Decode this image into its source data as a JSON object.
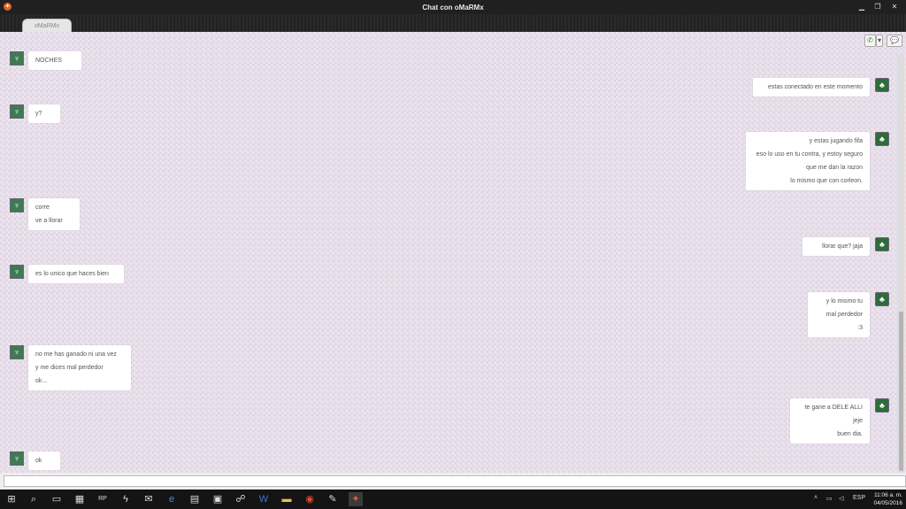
{
  "window": {
    "title": "Chat con oMaRMx"
  },
  "tab": {
    "label": "oMaRMx"
  },
  "toolbar": {
    "call_glyph": "✆",
    "dropdown_glyph": "▾",
    "chat_glyph": "💬"
  },
  "messages": [
    {
      "side": "left",
      "lines": [
        "NOCHES"
      ]
    },
    {
      "side": "right",
      "lines": [
        "estas conectado en este momento"
      ]
    },
    {
      "side": "left",
      "lines": [
        "y?"
      ]
    },
    {
      "side": "right",
      "lines": [
        "y estas jugando fifa",
        "eso lo uso en tu contra, y estoy seguro",
        "que me dan la razon",
        "lo mismo que con corleon."
      ]
    },
    {
      "side": "left",
      "lines": [
        "corre",
        "ve a llorar"
      ]
    },
    {
      "side": "right",
      "lines": [
        "llorar que? jaja"
      ]
    },
    {
      "side": "left",
      "lines": [
        "es lo unico que haces bien"
      ]
    },
    {
      "side": "right",
      "lines": [
        "y lo mismo tu",
        "mal perdedor",
        ":3"
      ]
    },
    {
      "side": "left",
      "lines": [
        "no me has ganado ni una vez",
        "y me dices mal perdedor",
        "ok..."
      ]
    },
    {
      "side": "right",
      "lines": [
        "te gane a DELE ALLI",
        "jeje",
        "buen dia."
      ]
    },
    {
      "side": "left",
      "lines": [
        "ok"
      ]
    }
  ],
  "input": {
    "value": "",
    "placeholder": ""
  },
  "taskbar": {
    "lang": "ESP",
    "time": "11:06 a. m.",
    "date": "04/05/2016",
    "icons": [
      "search-icon",
      "task-view-icon",
      "store-icon",
      "rp-icon",
      "flash-icon",
      "mail-icon",
      "edge-icon",
      "calculator-icon",
      "explorer-icon",
      "network-icon",
      "word-icon",
      "folder-icon",
      "chrome-icon",
      "tool-icon",
      "chat-app-icon"
    ]
  }
}
